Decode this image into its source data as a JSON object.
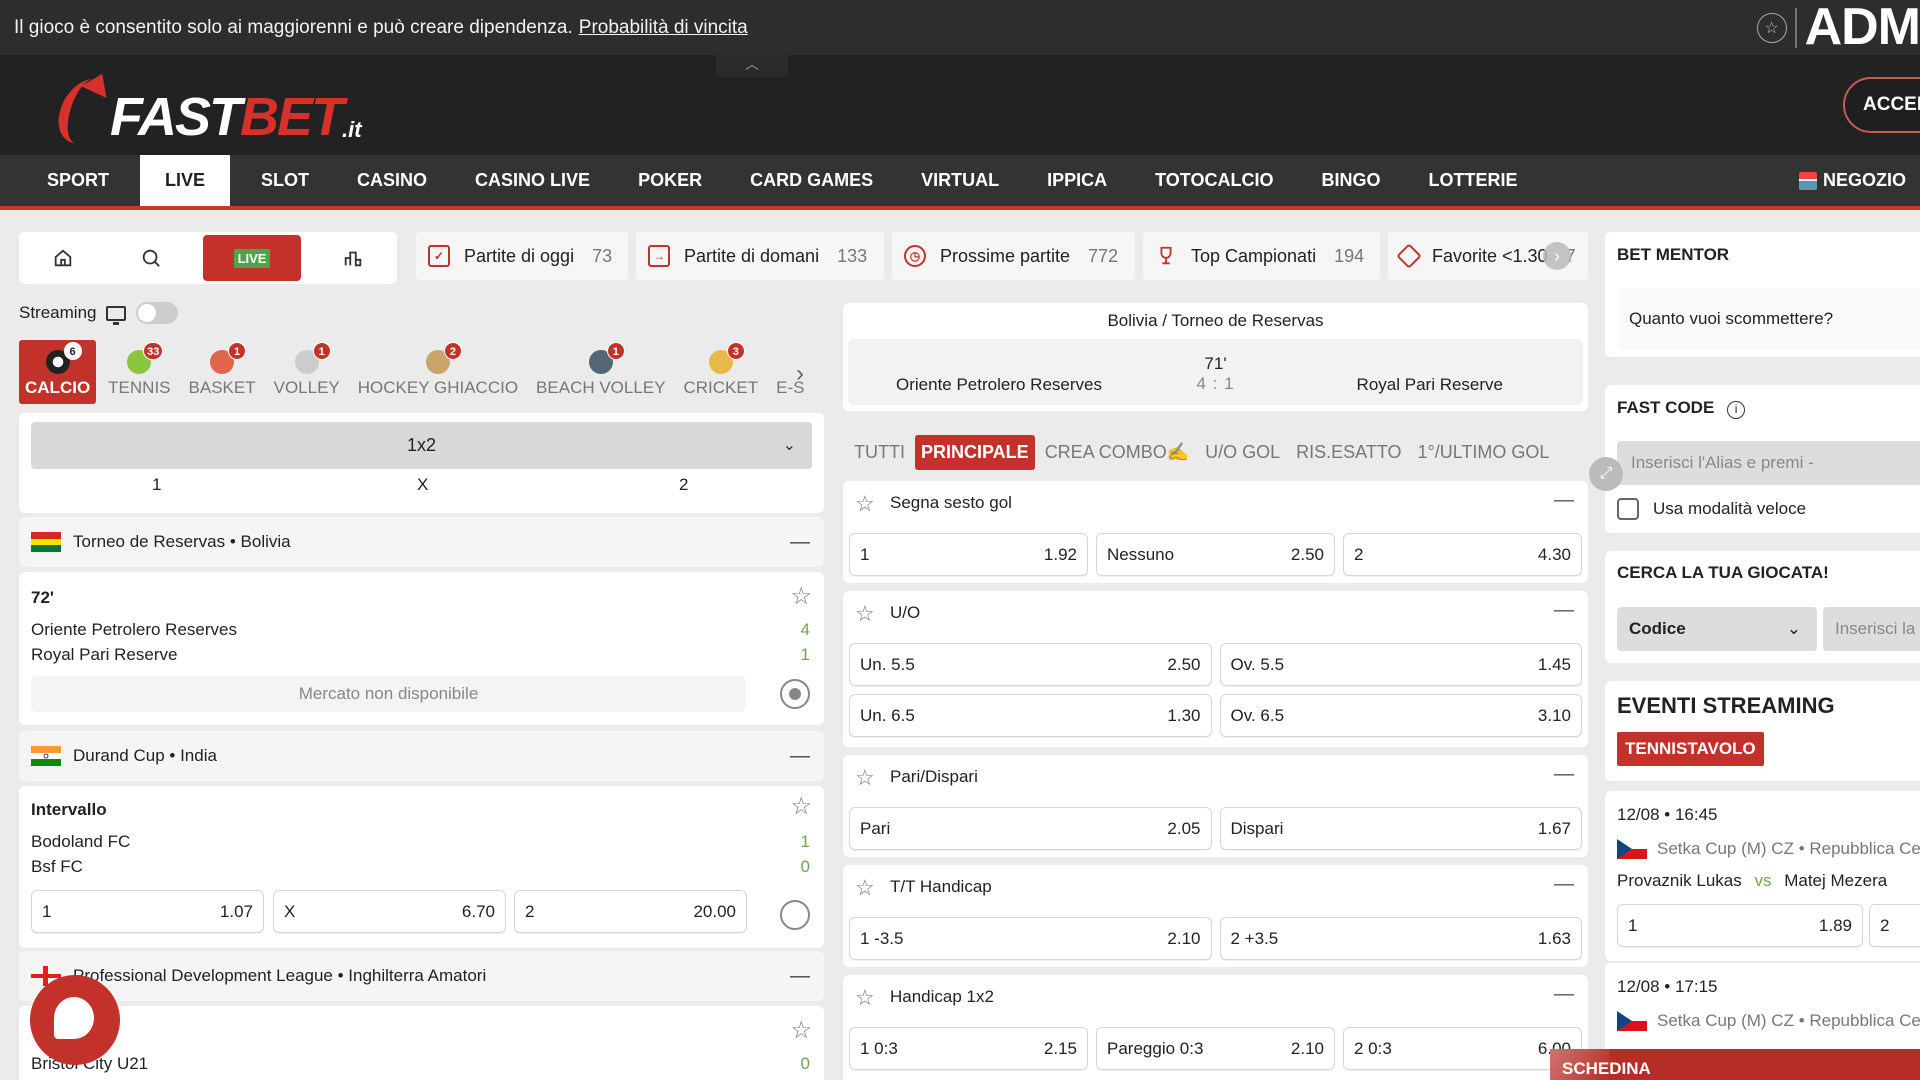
{
  "notice": {
    "text": "Il gioco è consentito solo ai maggiorenni e può creare dipendenza.",
    "link": "Probabilità di vincita",
    "regulator": "ADM"
  },
  "header": {
    "logo_fast": "FAST",
    "logo_bet": "BET",
    "logo_tld": ".it",
    "login_label": "ACCEDI",
    "collapse_icon": "chevron-up-icon"
  },
  "nav": {
    "items": [
      {
        "label": "SPORT",
        "active": false
      },
      {
        "label": "LIVE",
        "active": true
      },
      {
        "label": "SLOT",
        "active": false
      },
      {
        "label": "CASINO",
        "active": false
      },
      {
        "label": "CASINO LIVE",
        "active": false
      },
      {
        "label": "POKER",
        "active": false
      },
      {
        "label": "CARD GAMES",
        "active": false
      },
      {
        "label": "VIRTUAL",
        "active": false
      },
      {
        "label": "IPPICA",
        "active": false
      },
      {
        "label": "TOTOCALCIO",
        "active": false
      },
      {
        "label": "BINGO",
        "active": false
      },
      {
        "label": "LOTTERIE",
        "active": false
      }
    ],
    "shop_label": "NEGOZIO"
  },
  "toolbar": {
    "live_label": "LIVE",
    "icons": [
      "home-icon",
      "search-icon",
      "live-icon",
      "stats-icon"
    ]
  },
  "quick_links": [
    {
      "label": "Partite di oggi",
      "count": "73",
      "icon": "calendar-check-icon"
    },
    {
      "label": "Partite di domani",
      "count": "133",
      "icon": "calendar-next-icon"
    },
    {
      "label": "Prossime partite",
      "count": "772",
      "icon": "clock-icon"
    },
    {
      "label": "Top Campionati",
      "count": "194",
      "icon": "trophy-icon"
    },
    {
      "label": "Favorite <1.30",
      "count": "7",
      "icon": "diamond-arrow-icon"
    }
  ],
  "streaming": {
    "label": "Streaming",
    "enabled": false
  },
  "sports": [
    {
      "label": "CALCIO",
      "count": "6",
      "active": true,
      "color": "#222222"
    },
    {
      "label": "TENNIS",
      "count": "33",
      "active": false,
      "color": "#8bc53f"
    },
    {
      "label": "BASKET",
      "count": "1",
      "active": false,
      "color": "#e0654a"
    },
    {
      "label": "VOLLEY",
      "count": "1",
      "active": false,
      "color": "#cccccc"
    },
    {
      "label": "HOCKEY GHIACCIO",
      "count": "2",
      "active": false,
      "color": "#c8a46a"
    },
    {
      "label": "BEACH VOLLEY",
      "count": "1",
      "active": false,
      "color": "#556677"
    },
    {
      "label": "CRICKET",
      "count": "3",
      "active": false,
      "color": "#e8b84a"
    },
    {
      "label": "E-S",
      "count": "",
      "active": false,
      "color": "#999999"
    }
  ],
  "market_selector": {
    "value": "1x2",
    "columns": [
      "1",
      "X",
      "2"
    ]
  },
  "leagues": [
    {
      "name": "Torneo de Reservas • Bolivia",
      "match": {
        "status": "72'",
        "home": "Oriente Petrolero Reserves",
        "home_score": "4",
        "away": "Royal Pari Reserve",
        "away_score": "1",
        "unavailable": "Mercato non disponibile"
      }
    },
    {
      "name": "Durand Cup • India",
      "match": {
        "status": "Intervallo",
        "home": "Bodoland FC",
        "home_score": "1",
        "away": "Bsf FC",
        "away_score": "0",
        "odds": [
          {
            "label": "1",
            "value": "1.07"
          },
          {
            "label": "X",
            "value": "6.70"
          },
          {
            "label": "2",
            "value": "20.00"
          }
        ]
      }
    },
    {
      "name": "Professional Development League • Inghilterra Amatori",
      "match": {
        "status": "",
        "home": "",
        "home_score": "",
        "away": "Bristol City U21",
        "away_score": "0"
      }
    }
  ],
  "event": {
    "breadcrumb": "Bolivia / Torneo de Reservas",
    "home": "Oriente Petrolero Reserves",
    "away": "Royal Pari Reserve",
    "minute": "71'",
    "score": "4 : 1"
  },
  "market_tabs": [
    {
      "label": "TUTTI",
      "active": false
    },
    {
      "label": "PRINCIPALE",
      "active": true
    },
    {
      "label": "CREA COMBO✍",
      "active": false
    },
    {
      "label": "U/O GOL",
      "active": false
    },
    {
      "label": "RIS.ESATTO",
      "active": false
    },
    {
      "label": "1°/ULTIMO GOL",
      "active": false
    }
  ],
  "markets": [
    {
      "title": "Segna sesto gol",
      "rows": [
        [
          {
            "label": "1",
            "value": "1.92"
          },
          {
            "label": "Nessuno",
            "value": "2.50"
          },
          {
            "label": "2",
            "value": "4.30"
          }
        ]
      ]
    },
    {
      "title": "U/O",
      "rows": [
        [
          {
            "label": "Un. 5.5",
            "value": "2.50"
          },
          {
            "label": "Ov. 5.5",
            "value": "1.45"
          }
        ],
        [
          {
            "label": "Un. 6.5",
            "value": "1.30"
          },
          {
            "label": "Ov. 6.5",
            "value": "3.10"
          }
        ]
      ]
    },
    {
      "title": "Pari/Dispari",
      "rows": [
        [
          {
            "label": "Pari",
            "value": "2.05"
          },
          {
            "label": "Dispari",
            "value": "1.67"
          }
        ]
      ]
    },
    {
      "title": "T/T Handicap",
      "rows": [
        [
          {
            "label": "1 -3.5",
            "value": "2.10"
          },
          {
            "label": "2 +3.5",
            "value": "1.63"
          }
        ]
      ]
    },
    {
      "title": "Handicap 1x2",
      "rows": [
        [
          {
            "label": "1 0:3",
            "value": "2.15"
          },
          {
            "label": "Pareggio 0:3",
            "value": "2.10"
          },
          {
            "label": "2 0:3",
            "value": "6.00"
          }
        ]
      ]
    }
  ],
  "right": {
    "bet_mentor": {
      "title": "BET MENTOR",
      "question": "Quanto vuoi scommettere?"
    },
    "fast_code": {
      "title": "FAST CODE",
      "placeholder": "Inserisci l'Alias e premi -",
      "checkbox_label": "Usa modalità veloce"
    },
    "search": {
      "title": "CERCA LA TUA GIOCATA!",
      "select_value": "Codice",
      "input_placeholder": "Inserisci la"
    },
    "streaming_events": {
      "title": "EVENTI STREAMING",
      "tag": "TENNISTAVOLO",
      "events": [
        {
          "datetime": "12/08 • 16:45",
          "league": "Setka Cup (M) CZ • Repubblica Ceca",
          "home": "Provaznik Lukas",
          "vs": "vs",
          "away": "Matej Mezera",
          "odds": [
            {
              "label": "1",
              "value": "1.89"
            },
            {
              "label": "2",
              "value": ""
            }
          ]
        },
        {
          "datetime": "12/08 • 17:15",
          "league": "Setka Cup (M) CZ • Repubblica Ceca"
        }
      ]
    }
  },
  "betslip": {
    "label": "SCHEDINA"
  },
  "colors": {
    "brand": "#c3312b",
    "score_green": "#6aa84f",
    "live_green": "#4fa34a"
  }
}
